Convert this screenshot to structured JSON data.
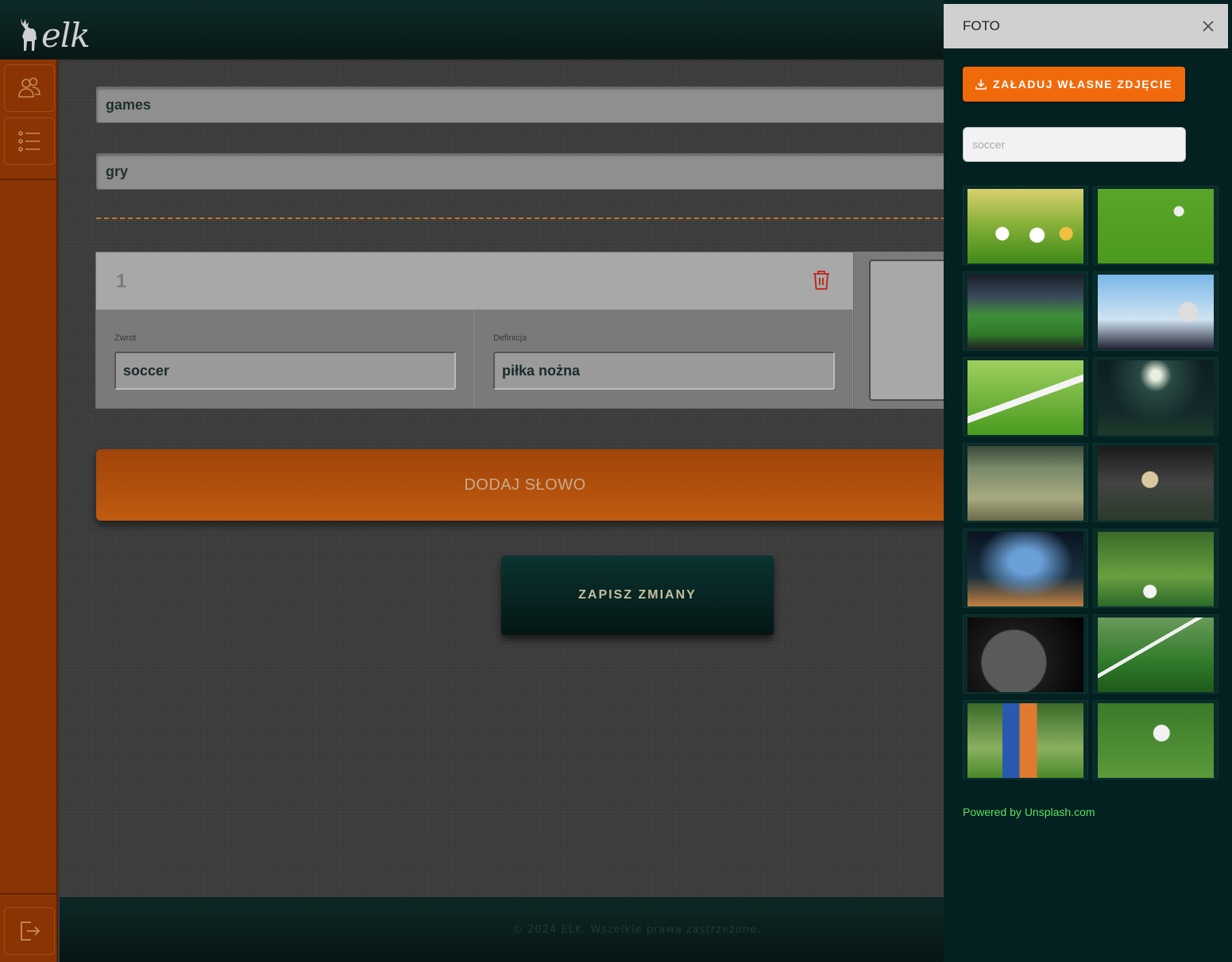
{
  "header": {
    "logo_text": "elk"
  },
  "sidebar": {
    "items": [
      {
        "name": "users",
        "icon": "users-icon"
      },
      {
        "name": "list",
        "icon": "list-icon"
      }
    ],
    "logout_icon": "logout-icon"
  },
  "form": {
    "title_value": "games",
    "translation_value": "gry",
    "words": [
      {
        "number": "1",
        "phrase_label": "Zwrot",
        "phrase_value": "soccer",
        "definition_label": "Definicja",
        "definition_value": "piłka nożna"
      }
    ],
    "add_word_label": "DODAJ SŁOWO",
    "save_label": "ZAPISZ ZMIANY"
  },
  "footer": {
    "text": "© 2024 ELK. Wszelkie prawa zastrzeżone."
  },
  "photo_panel": {
    "title": "FOTO",
    "upload_label": "ZAŁADUJ WŁASNE ZDJĘCIE",
    "search_placeholder": "soccer",
    "powered_by": "Powered by Unsplash.com",
    "accent_color": "#f06a0c",
    "photos": [
      "soccer-balls-on-grass",
      "player-feet-with-ball",
      "stadium-interior",
      "ball-in-goal-net",
      "pitch-white-line",
      "stadium-night-floodlight",
      "players-tackling",
      "player-dribbling-orange-boots",
      "silhouette-foggy-pitch",
      "player-blue-boots-ball",
      "black-ball-closeup",
      "goal-post-corner",
      "blue-vs-orange-match",
      "players-legs-duel"
    ]
  }
}
